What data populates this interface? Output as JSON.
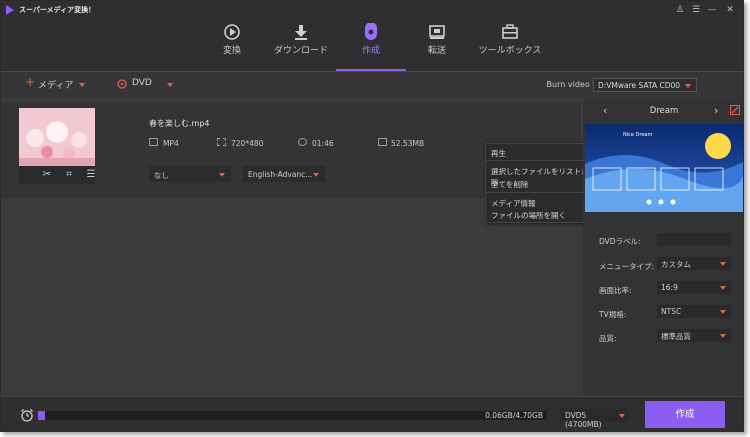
{
  "app": {
    "title": "スーパーメディア変換！"
  },
  "nav": {
    "tabs": [
      {
        "label": "変換",
        "icon": "convert-icon"
      },
      {
        "label": "ダウンロード",
        "icon": "download-icon"
      },
      {
        "label": "作成",
        "icon": "burn-disc-icon",
        "active": true
      },
      {
        "label": "転送",
        "icon": "transfer-icon"
      },
      {
        "label": "ツールボックス",
        "icon": "toolbox-icon"
      }
    ]
  },
  "toolbar": {
    "add_media_label": "メディア",
    "dvd_label": "DVD",
    "burn_to_label": "Burn video to:",
    "burn_target": "D:VMware SATA CD00"
  },
  "file": {
    "name": "春を楽しむ.mp4",
    "format": "MP4",
    "resolution": "720*480",
    "duration": "01:46",
    "size": "52.53MB",
    "subtitle_select": "なし",
    "audio_select": "English-Advanc..."
  },
  "context_menu": {
    "items": [
      "再生",
      "選択したファイルをリストから削除",
      "全てを削除",
      "メディア情報",
      "ファイルの場所を開く"
    ]
  },
  "theme": {
    "title": "Dream",
    "preview_caption": "Nice Dream"
  },
  "settings": {
    "dvd_label": {
      "label": "DVDラベル:",
      "value": ""
    },
    "menu_type": {
      "label": "メニュータイプ:",
      "value": "カスタム"
    },
    "aspect": {
      "label": "画面比率:",
      "value": "16:9"
    },
    "tv_standard": {
      "label": "TV規格:",
      "value": "NTSC"
    },
    "quality": {
      "label": "品質:",
      "value": "標準品質"
    }
  },
  "bottom": {
    "progress_text": "0.06GB/4.70GB",
    "progress_fraction": 0.0128,
    "disc_type": "DVD5 (4700MB)",
    "create_label": "作成"
  },
  "colors": {
    "accent": "#8b5df0",
    "caret": "#e0604a"
  }
}
